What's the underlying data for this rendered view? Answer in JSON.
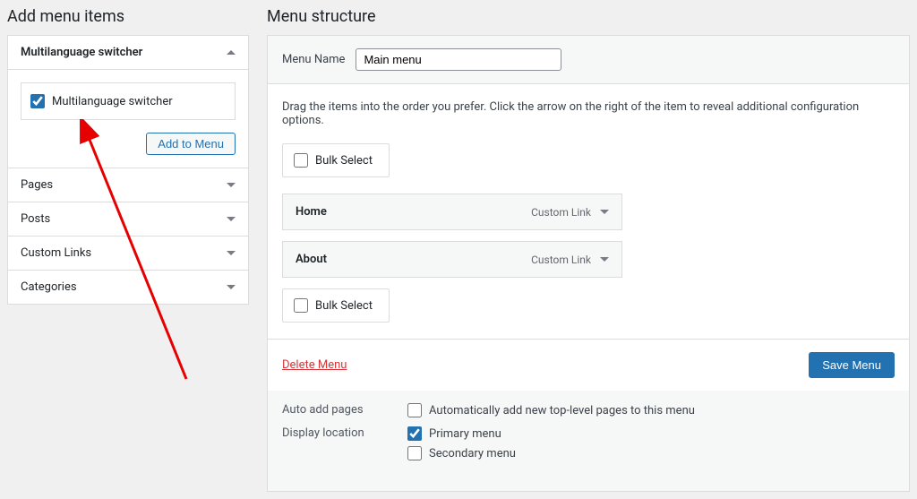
{
  "left": {
    "heading": "Add menu items",
    "open_section": {
      "title": "Multilanguage switcher",
      "checkbox_label": "Multilanguage switcher",
      "checkbox_checked": true,
      "add_button": "Add to Menu"
    },
    "collapsed": [
      "Pages",
      "Posts",
      "Custom Links",
      "Categories"
    ]
  },
  "right": {
    "heading": "Menu structure",
    "menu_name_label": "Menu Name",
    "menu_name_value": "Main menu",
    "instructions": "Drag the items into the order you prefer. Click the arrow on the right of the item to reveal additional configuration options.",
    "bulk_select": "Bulk Select",
    "items": [
      {
        "label": "Home",
        "type": "Custom Link"
      },
      {
        "label": "About",
        "type": "Custom Link"
      }
    ],
    "delete_label": "Delete Menu",
    "save_label": "Save Menu",
    "settings": {
      "auto_add_label": "Auto add pages",
      "auto_add_option": "Automatically add new top-level pages to this menu",
      "display_location_label": "Display location",
      "locations": [
        {
          "label": "Primary menu",
          "checked": true
        },
        {
          "label": "Secondary menu",
          "checked": false
        }
      ]
    }
  }
}
